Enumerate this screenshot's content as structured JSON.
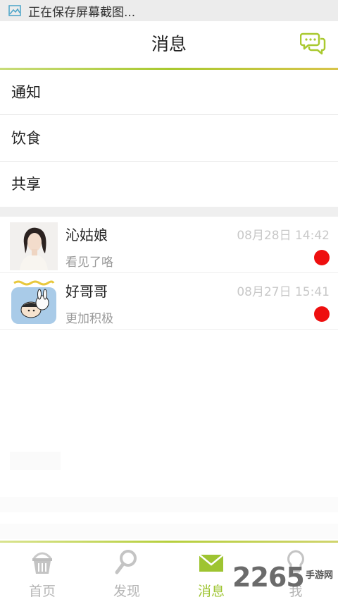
{
  "status_bar": {
    "text": "正在保存屏幕截图..."
  },
  "header": {
    "title": "消息"
  },
  "menu": [
    {
      "label": "通知"
    },
    {
      "label": "饮食"
    },
    {
      "label": "共享"
    }
  ],
  "conversations": [
    {
      "name": "沁姑娘",
      "time": "08月28日 14:42",
      "preview": "看见了咯",
      "unread": true
    },
    {
      "name": "好哥哥",
      "time": "08月27日 15:41",
      "preview": "更加积极",
      "unread": true
    }
  ],
  "tabs": [
    {
      "label": "首页",
      "icon": "basket-icon",
      "active": false
    },
    {
      "label": "发现",
      "icon": "magnifier-icon",
      "active": false
    },
    {
      "label": "消息",
      "icon": "envelope-icon",
      "active": true
    },
    {
      "label": "我",
      "icon": "lightbulb-icon",
      "active": false
    }
  ],
  "watermark": {
    "number": "2265",
    "site": "手游网"
  },
  "colors": {
    "accent": "#9ec431",
    "unread_dot": "#ee0f0f",
    "inactive_tab": "#b5b5b5"
  }
}
